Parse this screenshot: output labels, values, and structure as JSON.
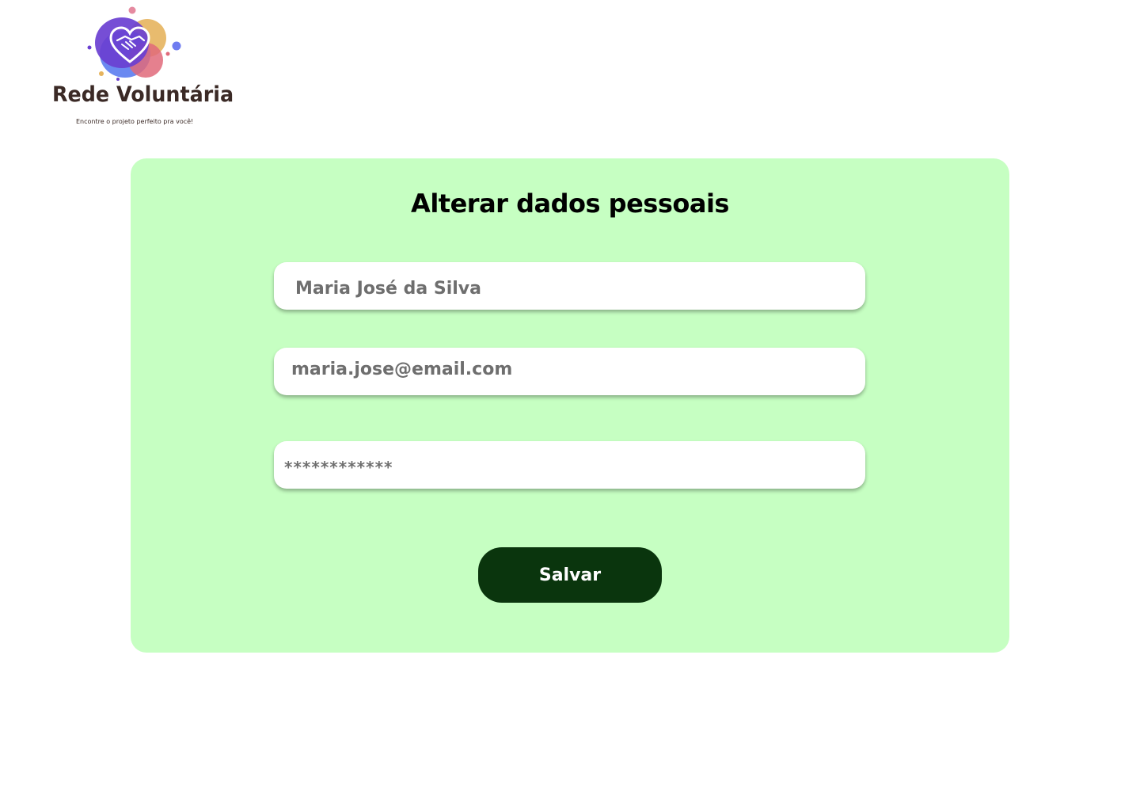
{
  "logo": {
    "name": "Rede Voluntária",
    "tagline": "Encontre o projeto perfeito pra você!",
    "icon": "heart-handshake-icon",
    "colors": [
      "#6a3fd1",
      "#5b7cf0",
      "#e6b45e",
      "#e06a7a",
      "#3b2a26"
    ]
  },
  "form": {
    "title": "Alterar dados pessoais",
    "name_value": "Maria José da Silva",
    "email_value": "maria.jose@email.com",
    "password_value": "************",
    "save_label": "Salvar"
  },
  "colors": {
    "card_background": "#c6ffc2",
    "button_background": "#0a350d",
    "input_text": "#6e6e6e"
  }
}
